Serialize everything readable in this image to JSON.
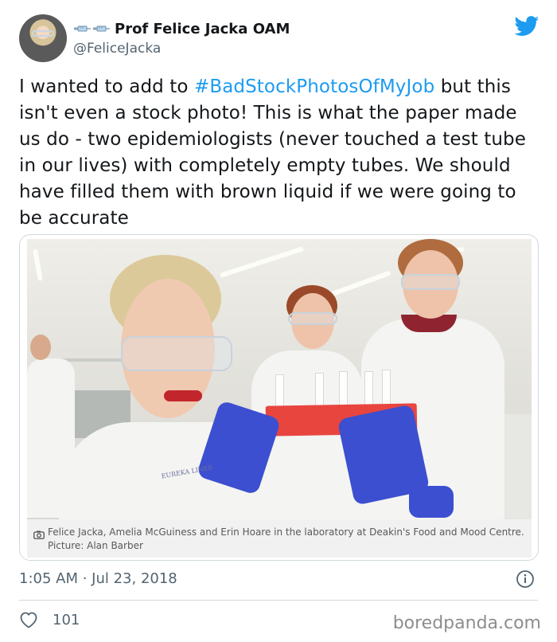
{
  "user": {
    "display_name": "Prof Felice Jacka OAM",
    "handle": "@FeliceJacka",
    "name_emojis": [
      "syringe-icon",
      "syringe-icon"
    ]
  },
  "tweet": {
    "text_before": "I wanted to add to ",
    "hashtag": "#BadStockPhotosOfMyJob",
    "text_after": " but this isn't even a stock photo! This is what the paper made us do - two epidemiologists (never touched a test tube in our lives) with completely empty tubes. We should have filled them with brown liquid if we were going to be accurate"
  },
  "media": {
    "caption": "Felice Jacka, Amelia McGuiness and Erin Hoare in the laboratory at Deakin's Food and Mood Centre. Picture: Alan Barber",
    "coat_badge": "EUREKA LINES"
  },
  "footer": {
    "timestamp": "1:05 AM · Jul 23, 2018",
    "like_count": "101"
  },
  "watermark": "boredpanda.com",
  "colors": {
    "accent": "#1d9bf0",
    "text": "#14171a",
    "muted": "#536471"
  }
}
